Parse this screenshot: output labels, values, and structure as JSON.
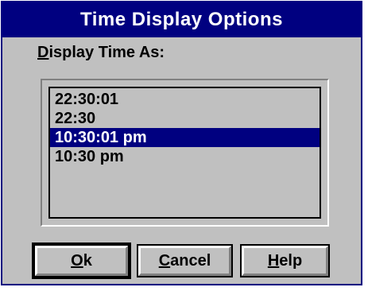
{
  "dialog": {
    "title": "Time Display Options",
    "label_mnemonic": "D",
    "label_rest": "isplay Time As:"
  },
  "list": {
    "items": [
      {
        "text": "22:30:01",
        "selected": false
      },
      {
        "text": "22:30",
        "selected": false
      },
      {
        "text": "10:30:01 pm",
        "selected": true
      },
      {
        "text": "10:30 pm",
        "selected": false
      }
    ]
  },
  "buttons": {
    "ok_mnemonic": "O",
    "ok_rest": "k",
    "cancel_mnemonic": "C",
    "cancel_rest": "ancel",
    "help_mnemonic": "H",
    "help_rest": "elp"
  },
  "colors": {
    "face": "#c0c0c0",
    "titlebar": "#000080",
    "selection": "#000080"
  }
}
